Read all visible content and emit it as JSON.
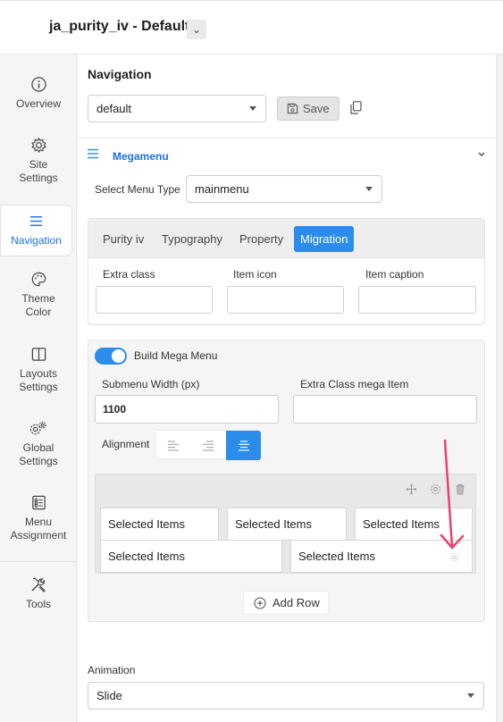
{
  "header": {
    "title": "ja_purity_iv - Default",
    "title_caret": "⌄"
  },
  "sidebar": {
    "items": [
      {
        "label": "Overview",
        "icon": "info-circle-icon"
      },
      {
        "label": "Site Settings",
        "icon": "gear-icon"
      },
      {
        "label": "Navigation",
        "icon": "hamburger-menu-icon"
      },
      {
        "label": "Theme Color",
        "icon": "palette-icon"
      },
      {
        "label": "Layouts Settings",
        "icon": "columns-layout-icon"
      },
      {
        "label": "Global Settings",
        "icon": "double-gear-icon"
      },
      {
        "label": "Menu Assignment",
        "icon": "checklist-icon"
      },
      {
        "label": "Tools",
        "icon": "wrench-screwdriver-icon"
      }
    ],
    "active": "Navigation"
  },
  "navigation": {
    "title": "Navigation",
    "profile_value": "default",
    "save_label": "Save"
  },
  "megamenu": {
    "label": "Megamenu",
    "menu_type_label": "Select Menu Type",
    "menu_type_value": "mainmenu",
    "tabs": [
      {
        "label": "Purity iv",
        "active": false
      },
      {
        "label": "Typography",
        "active": false
      },
      {
        "label": "Property",
        "active": false
      },
      {
        "label": "Migration",
        "active": true
      }
    ],
    "extra_class_label": "Extra class",
    "item_icon_label": "Item icon",
    "item_caption_label": "Item caption",
    "build_label": "Build Mega Menu",
    "build_enabled": true,
    "submenu_width_label": "Submenu Width (px)",
    "submenu_width_value": "1100",
    "extra_class_mega_label": "Extra Class mega Item",
    "alignment_label": "Alignment",
    "alignment_selected": "center",
    "cells": [
      "Selected Items",
      "Selected Items",
      "Selected Items",
      "Selected Items",
      "Selected Items"
    ],
    "add_row_label": "Add Row",
    "animation_label": "Animation",
    "animation_value": "Slide"
  },
  "colors": {
    "accent": "#2b8ceb",
    "annotation": "#e8436b"
  }
}
